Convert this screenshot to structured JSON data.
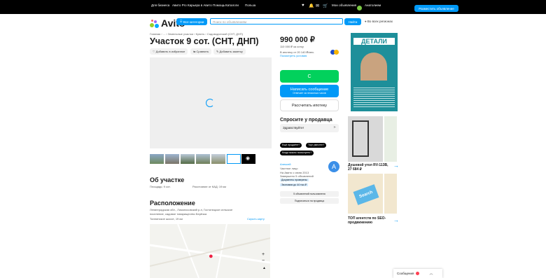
{
  "topbar": {
    "links": [
      "Для бизнеса",
      "Авито Pro",
      "Карьера в Авито",
      "Помощь",
      "Каталоги",
      "Польза"
    ],
    "my_ads": "Мои объявления",
    "user": "Анатолием",
    "place_ad": "Разместить объявление"
  },
  "header": {
    "logo": "Avito",
    "all_categories": "Все категории",
    "search_placeholder": "Поиск по объявлениям",
    "find": "Найти",
    "region": "Во всех регионах"
  },
  "listing": {
    "breadcrumb": "Главная › ... › Земельные участки › Купить › Садоводческий (СНТ, ДНП)",
    "title": "Участок 9 сот. (СНТ, ДНП)",
    "actions": [
      "Добавить в избранное",
      "Сравнить",
      "Добавить заметку"
    ],
    "about_title": "Об участке",
    "area": "Площадь: 9 сот.",
    "distance": "Расстояние от КАД: 19 км",
    "location_title": "Расположение",
    "address_line1": "Ленинградская обл., Ломоносовский р-н, Гостилицкое сельское",
    "address_line2": "поселение, садовое товарищество Берёзка",
    "highway": "Таллинское шоссе, 19 км",
    "hide_map": "Скрыть карту"
  },
  "sidebar": {
    "price": "990 000 ₽",
    "price_per": "110 000 ₽ за сотку",
    "mortgage_info": "В ипотеку от 20 140 ₽/мес.",
    "mortgage_link": "Посмотреть условия",
    "show_phone": "С",
    "write_message": "Написать сообщение",
    "write_sub": "Отвечает за несколько часов",
    "calc_mortgage": "Рассчитать ипотеку",
    "ask_title": "Спросите у продавца",
    "ask_input": "Здравствуйте!",
    "quick_questions": [
      "Ещё продаёте?",
      "Торг уместен?",
      "Когда можно посмотреть?"
    ],
    "seller_name": "Алексей",
    "seller_type": "Частное лицо",
    "seller_since": "На Авито с июня 2013",
    "seller_completed": "Завершено 5 объявлений",
    "seller_badge1": "Документы проверены",
    "seller_badge2": "Экономия до 44 тыс.₽",
    "seller_initial": "А",
    "ads_link": "5 объявлений пользователя",
    "subscribe": "Подписаться на продавца"
  },
  "ads": {
    "big_title": "ДЕТАЛИ",
    "ad2_title": "Душевой угол RV-113B,",
    "ad2_price": "27 684 ₽",
    "ad3_search": "Search",
    "ad3_title": "ТОП агентств по SEO-продвижению"
  },
  "footer": {
    "label": "Сообщения"
  },
  "colors": {
    "accent": "#0099f7",
    "green": "#02d15c",
    "black": "#000000"
  }
}
